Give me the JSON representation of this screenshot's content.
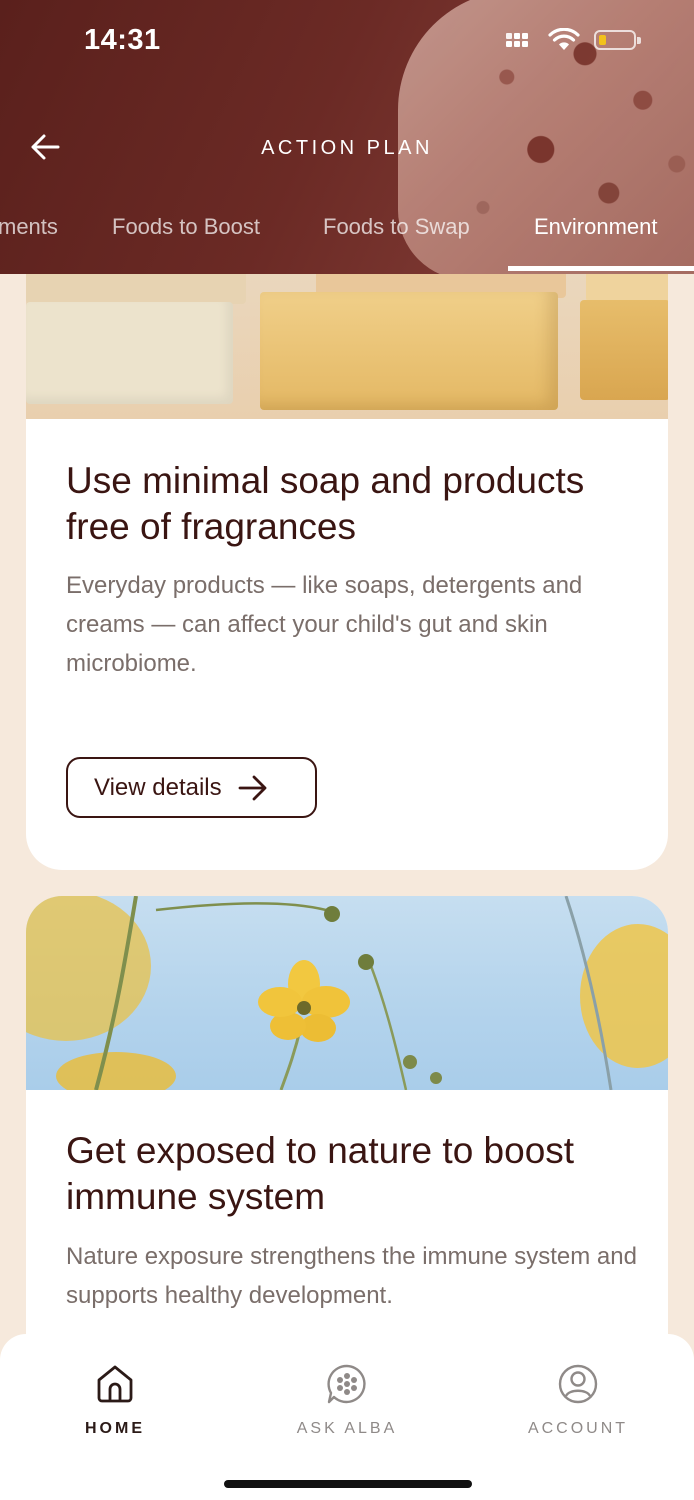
{
  "status_bar": {
    "time": "14:31"
  },
  "header": {
    "title": "ACTION PLAN",
    "back_icon": "arrow-left-icon"
  },
  "tabs": [
    {
      "label": "ments",
      "active": false
    },
    {
      "label": "Foods to Boost",
      "active": false
    },
    {
      "label": "Foods to Swap",
      "active": false
    },
    {
      "label": "Environment",
      "active": true
    }
  ],
  "cards": [
    {
      "image": "soap-bars-photo",
      "title": "Use minimal soap and products free of fragrances",
      "description": "Everyday products — like soaps, detergents and creams — can affect your child's gut and skin microbiome.",
      "button_label": "View details"
    },
    {
      "image": "yellow-flowers-sky-photo",
      "title": "Get exposed to nature to boost immune system",
      "description": "Nature exposure strengthens the immune system and supports healthy development."
    }
  ],
  "bottom_nav": [
    {
      "label": "HOME",
      "icon": "home-icon",
      "active": true
    },
    {
      "label": "ASK ALBA",
      "icon": "chat-bubble-icon",
      "active": false
    },
    {
      "label": "ACCOUNT",
      "icon": "account-icon",
      "active": false
    }
  ],
  "colors": {
    "header_bg": "#5a201c",
    "page_bg": "#f6e9dc",
    "title_text": "#3a1512",
    "body_text": "#7a6e6a",
    "battery_fill": "#f2c21c"
  }
}
